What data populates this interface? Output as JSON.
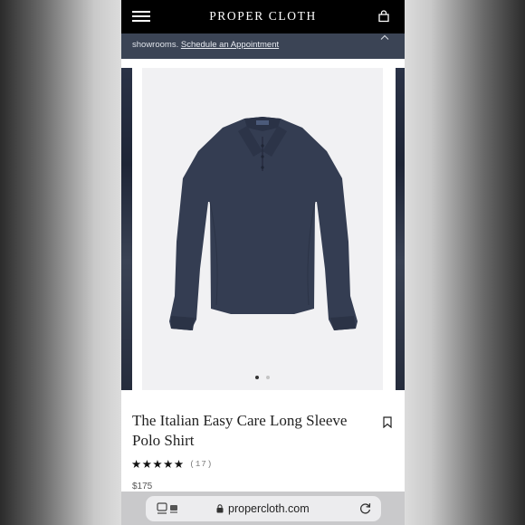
{
  "nav": {
    "brand": "PROPER CLOTH",
    "menu_icon": "hamburger-menu-icon",
    "bag_icon": "shopping-bag-icon"
  },
  "banner": {
    "text": "showrooms.",
    "link_label": "Schedule an Appointment",
    "collapse_icon": "chevron-up-icon"
  },
  "gallery": {
    "image_alt": "navy long sleeve polo shirt",
    "slide_count": 2,
    "active_slide": 1
  },
  "product": {
    "title": "The Italian Easy Care Long Sleeve Polo Shirt",
    "rating_stars": "★★★★★",
    "rating_value": 5,
    "review_count": "(17)",
    "price": "$175",
    "bookmark_icon": "bookmark-icon"
  },
  "browser": {
    "url": "propercloth.com",
    "reader_icon": "reader-mode-icon",
    "lock_icon": "lock-icon",
    "reload_icon": "reload-icon"
  },
  "colors": {
    "nav_bg": "#000000",
    "banner_bg": "#3b4455",
    "shirt": "#343d52",
    "image_bg": "#f1f1f3"
  }
}
